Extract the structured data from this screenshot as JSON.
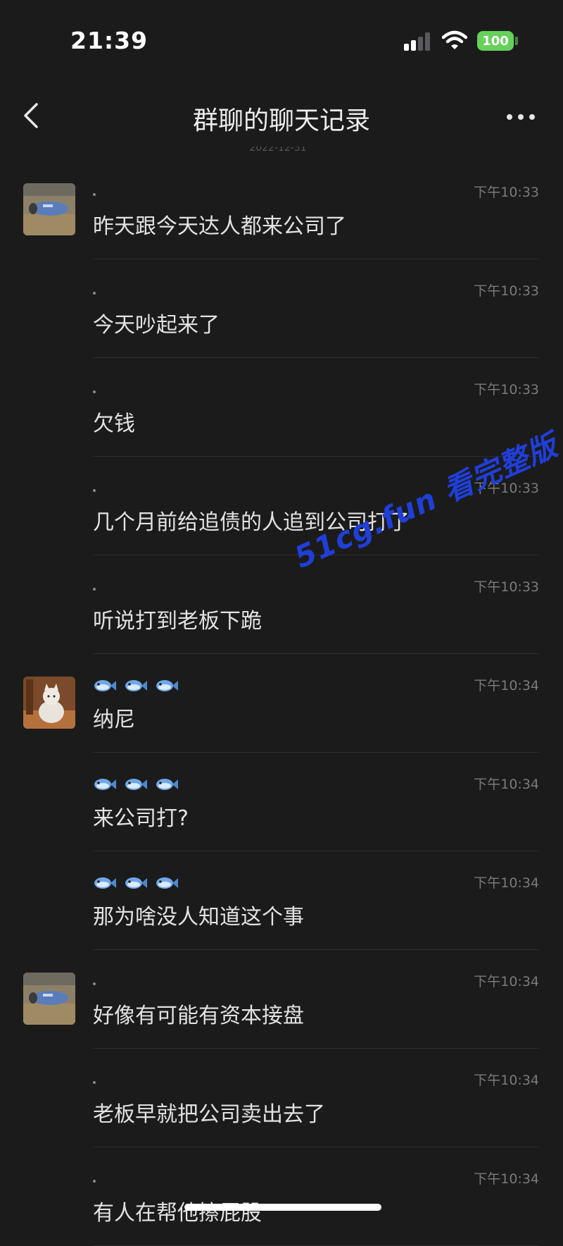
{
  "status_bar": {
    "time": "21:39",
    "battery": "100"
  },
  "nav": {
    "title": "群聊的聊天记录",
    "back_icon": "chevron-left-icon",
    "more_icon": "more-dots-icon"
  },
  "date_header": "2022-12-31",
  "messages": [
    {
      "avatar": "avatar-a",
      "sender": "dot",
      "time": "下午10:33",
      "text": "昨天跟今天达人都来公司了"
    },
    {
      "avatar": null,
      "sender": "dot",
      "time": "下午10:33",
      "text": "今天吵起来了"
    },
    {
      "avatar": null,
      "sender": "dot",
      "time": "下午10:33",
      "text": "欠钱"
    },
    {
      "avatar": null,
      "sender": "dot",
      "time": "下午10:33",
      "text": "几个月前给追债的人追到公司打了"
    },
    {
      "avatar": null,
      "sender": "dot",
      "time": "下午10:33",
      "text": "听说打到老板下跪"
    },
    {
      "avatar": "avatar-b",
      "sender": "fish",
      "time": "下午10:34",
      "text": "纳尼"
    },
    {
      "avatar": null,
      "sender": "fish",
      "time": "下午10:34",
      "text": "来公司打?"
    },
    {
      "avatar": null,
      "sender": "fish",
      "time": "下午10:34",
      "text": "那为啥没人知道这个事"
    },
    {
      "avatar": "avatar-a",
      "sender": "dot",
      "time": "下午10:34",
      "text": "好像有可能有资本接盘"
    },
    {
      "avatar": null,
      "sender": "dot",
      "time": "下午10:34",
      "text": "老板早就把公司卖出去了"
    },
    {
      "avatar": null,
      "sender": "dot",
      "time": "下午10:34",
      "text": "有人在帮他擦屁股"
    }
  ],
  "watermark": "51cg.fun 看完整版",
  "colors": {
    "background": "#1b1b1c",
    "battery": "#65d15b",
    "watermark": "#1f3fd8"
  }
}
